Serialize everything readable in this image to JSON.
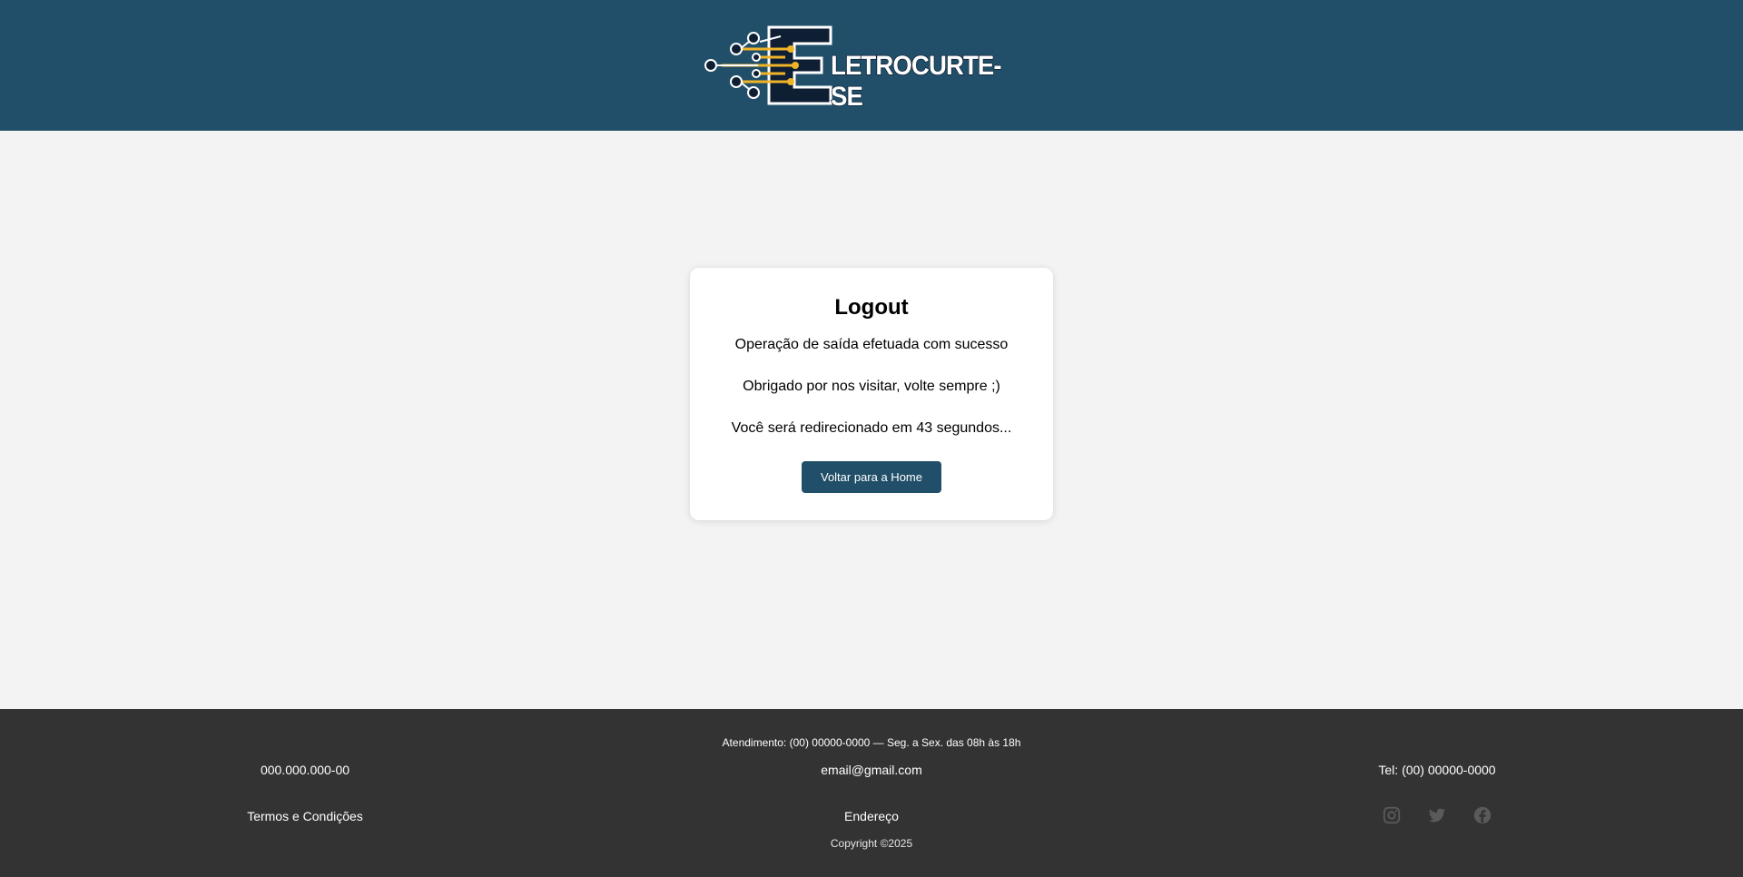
{
  "header": {
    "logo_alt": "Eletrocurte-se logo",
    "logo_text": "LETROCURTE-SE"
  },
  "card": {
    "title": "Logout",
    "message1": "Operação de saída efetuada com sucesso",
    "message2": "Obrigado por nos visitar, volte sempre ;)",
    "countdown_text": "Você será redirecionado em 43 segundos...",
    "button_label": "Voltar para a Home"
  },
  "footer": {
    "atendimento": "Atendimento: (00) 00000-0000 — Seg. a Sex. das 08h às 18h",
    "cnpj": "000.000.000-00",
    "email": "email@gmail.com",
    "phone": "Tel: (00) 00000-0000",
    "terms": "Termos e Condições",
    "address": "Endereço",
    "copyright": "Copyright ©2025",
    "social": [
      "instagram-icon",
      "twitter-icon",
      "facebook-icon"
    ]
  },
  "colors": {
    "header_bg": "#214f69",
    "page_bg": "#f3f3f3",
    "footer_bg": "#333333",
    "button_bg": "#214f69",
    "logo_accent": "#f0b429"
  }
}
